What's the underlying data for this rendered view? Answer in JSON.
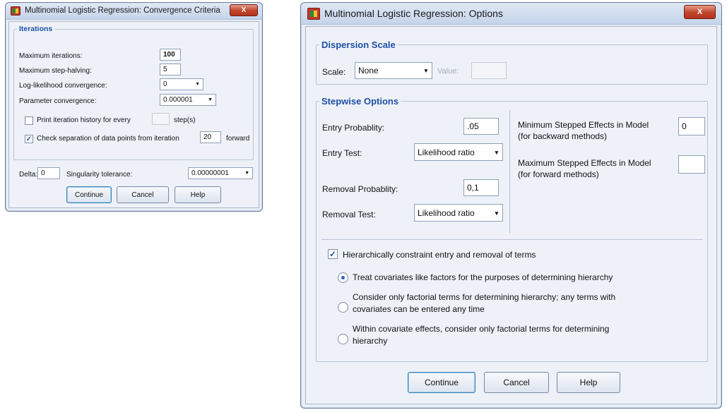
{
  "conv": {
    "title": "Multinomial Logistic Regression: Convergence Criteria",
    "close": "X",
    "iterations_legend": "Iterations",
    "max_iter_label": "Maximum iterations:",
    "max_iter_value": "100",
    "max_step_label": "Maximum step-halving:",
    "max_step_value": "5",
    "loglik_label": "Log-likelihood convergence:",
    "loglik_value": "0",
    "param_label": "Parameter convergence:",
    "param_value": "0.000001",
    "print_history_label": "Print iteration history for every",
    "print_history_value": "",
    "print_history_suffix": "step(s)",
    "print_history_checked": false,
    "check_sep_label": "Check separation of data points from iteration",
    "check_sep_value": "20",
    "check_sep_suffix": "forward",
    "check_sep_checked": true,
    "delta_label": "Delta:",
    "delta_value": "0",
    "singularity_label": "Singularity tolerance:",
    "singularity_value": "0.00000001",
    "buttons": {
      "continue": "Continue",
      "cancel": "Cancel",
      "help": "Help"
    }
  },
  "opts": {
    "title": "Multinomial Logistic Regression: Options",
    "close": "X",
    "dispersion_legend": "Dispersion Scale",
    "scale_label": "Scale:",
    "scale_value": "None",
    "value_label": "Value:",
    "value_value": "",
    "stepwise_legend": "Stepwise Options",
    "entry_prob_label": "Entry Probablity:",
    "entry_prob_value": ".05",
    "entry_test_label": "Entry Test:",
    "entry_test_value": "Likelihood ratio",
    "removal_prob_label": "Removal Probablity:",
    "removal_prob_value": "0,1",
    "removal_test_label": "Removal Test:",
    "removal_test_value": "Likelihood ratio",
    "min_effects_label_1": "Minimum Stepped Effects in Model",
    "min_effects_label_2": "(for backward methods)",
    "min_effects_value": "0",
    "max_effects_label_1": "Maximum Stepped Effects in Model",
    "max_effects_label_2": "(for forward methods)",
    "max_effects_value": "",
    "hier_label": "Hierarchically constraint entry and removal of terms",
    "hier_checked": true,
    "radio1": "Treat covariates like factors for the purposes of determining hierarchy",
    "radio2_line1": "Consider only factorial terms for determining hierarchy; any terms with",
    "radio2_line2": "covariates can be entered any time",
    "radio3_line1": "Within covariate effects, consider only factorial terms for determining",
    "radio3_line2": "hierarchy",
    "radio_selected": 1,
    "buttons": {
      "continue": "Continue",
      "cancel": "Cancel",
      "help": "Help"
    }
  }
}
